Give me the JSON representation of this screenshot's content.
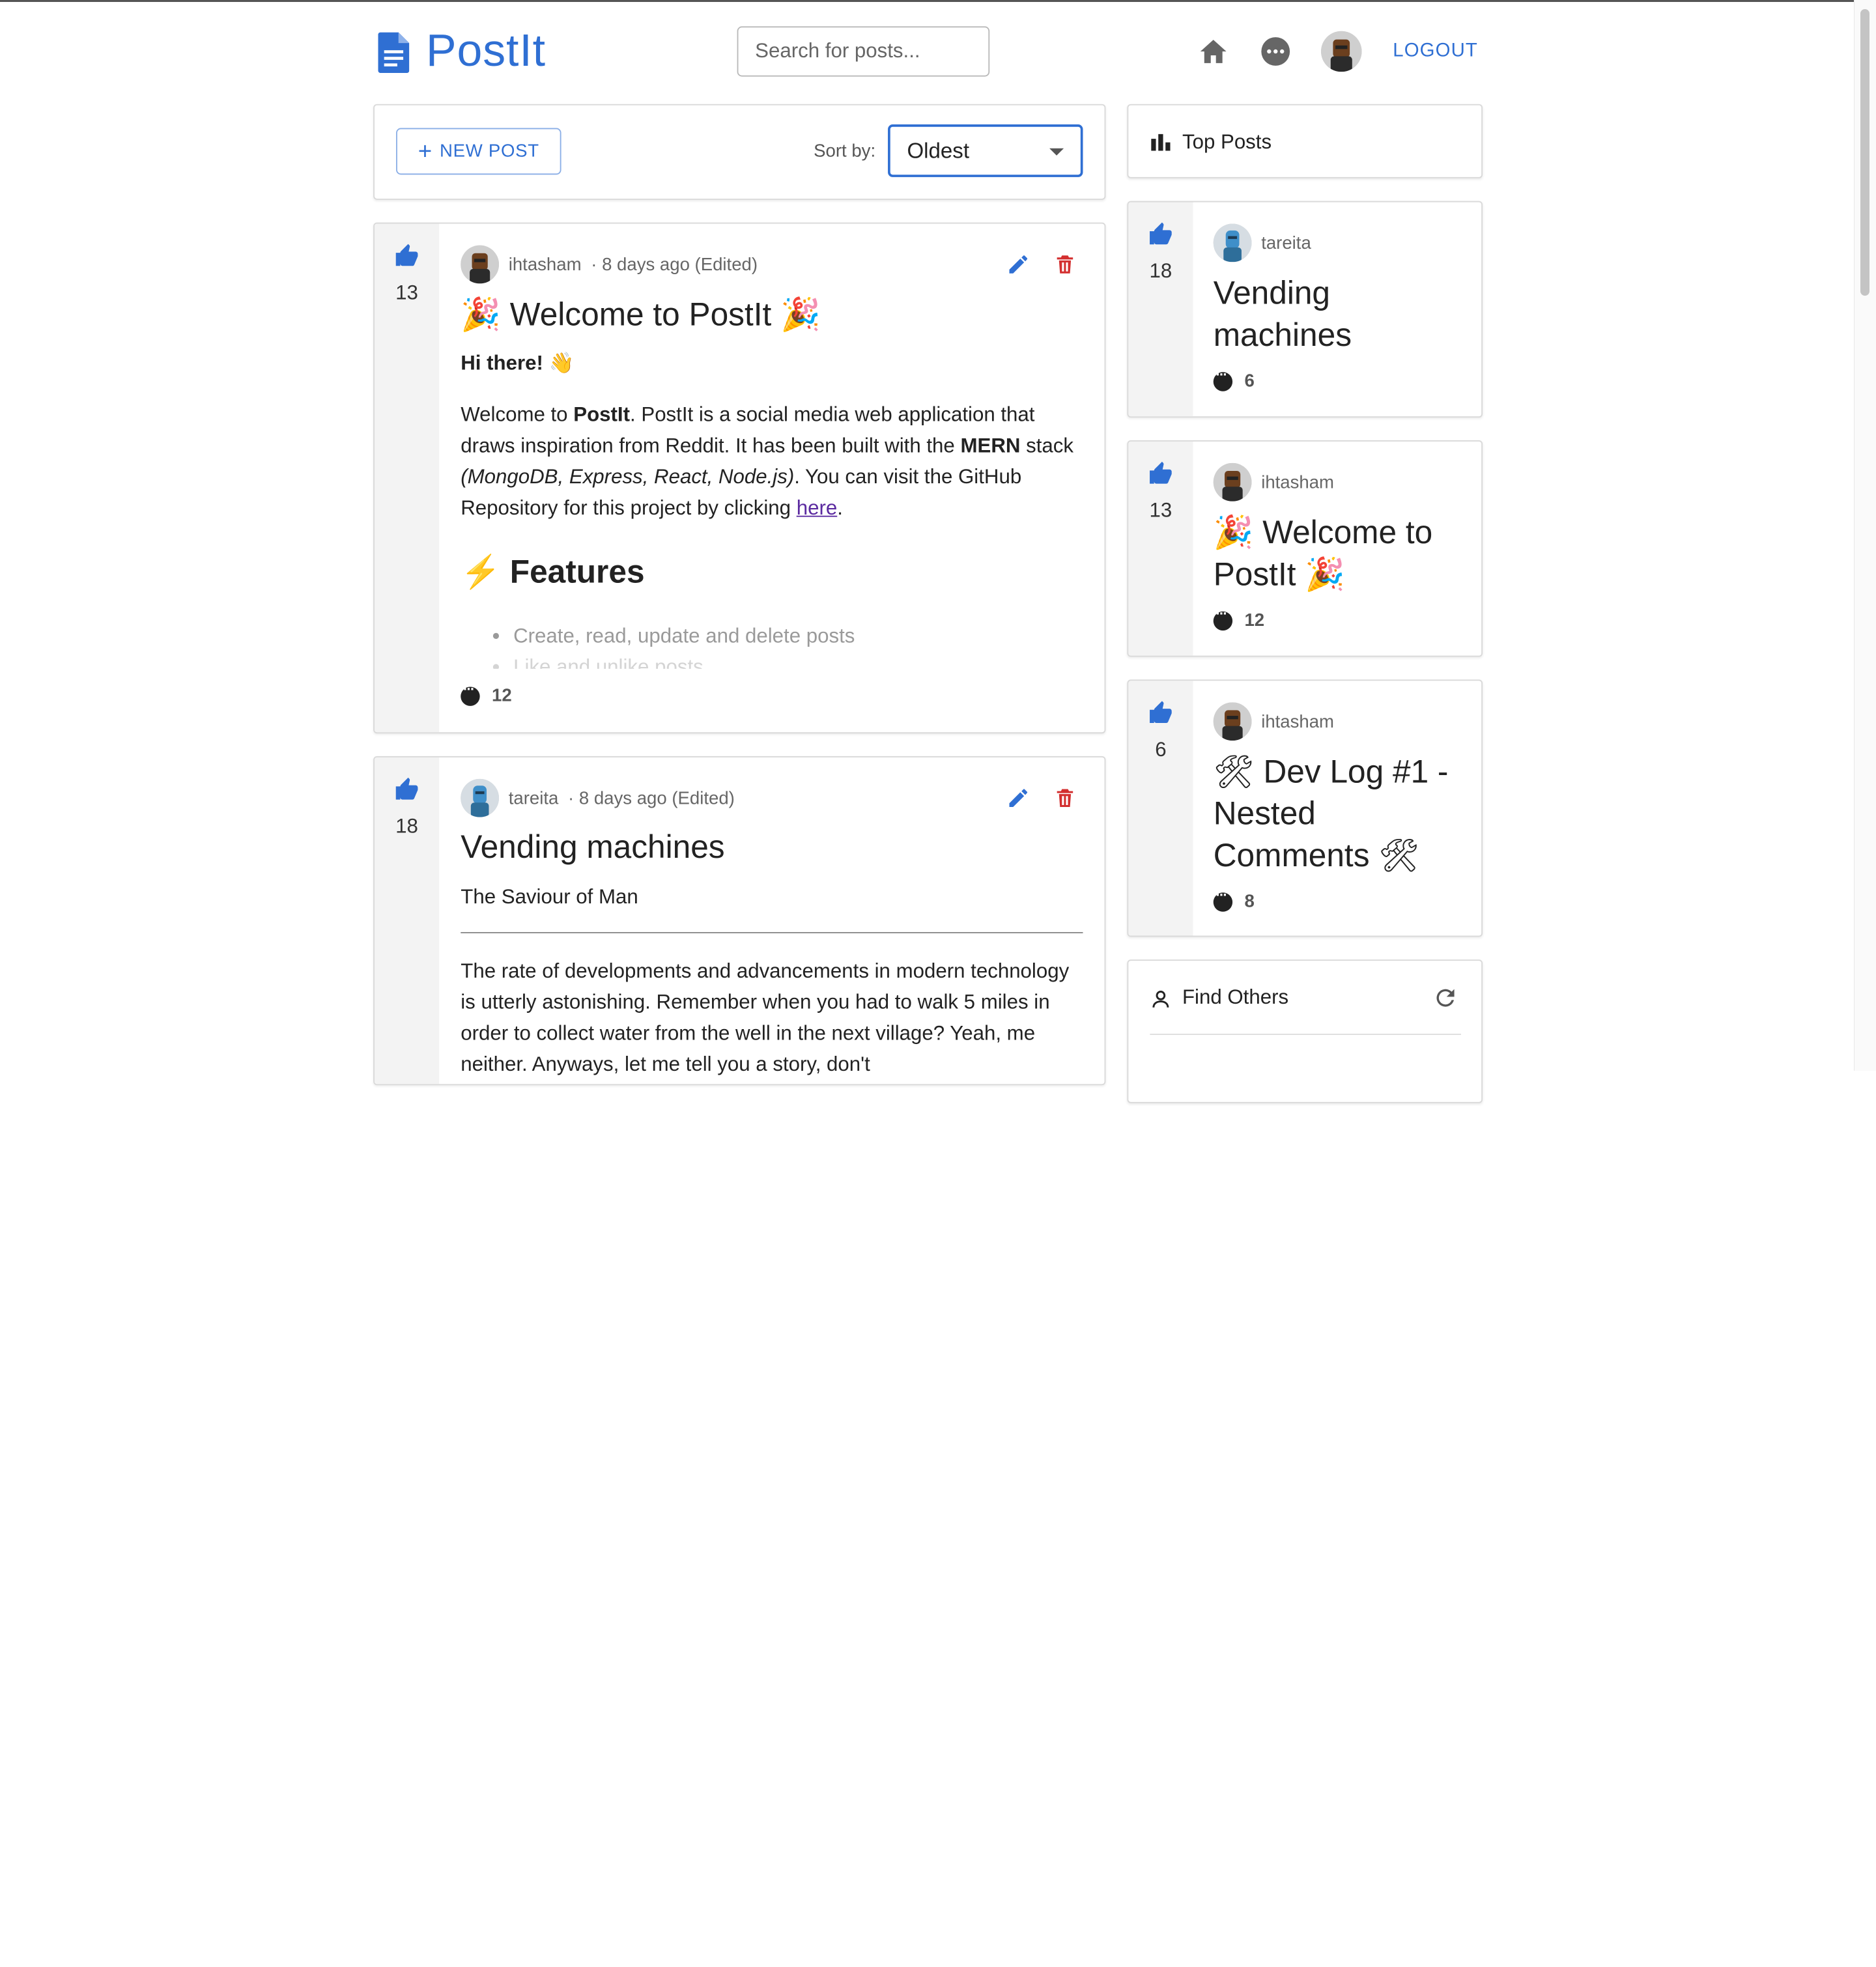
{
  "app": {
    "name": "PostIt"
  },
  "search": {
    "placeholder": "Search for posts..."
  },
  "nav": {
    "logout_label": "LOGOUT"
  },
  "toolbar": {
    "new_post_label": "NEW POST",
    "sort_label": "Sort by:",
    "sort_value": "Oldest"
  },
  "feed": {
    "posts": [
      {
        "likes": "13",
        "author": "ihtasham",
        "meta_suffix": "· 8 days ago (Edited)",
        "title": "🎉 Welcome to PostIt 🎉",
        "greeting": "Hi there! 👋",
        "body_intro": "Welcome to ",
        "body_brand": "PostIt",
        "body_mid": ". PostIt is a social media web application that draws inspiration from Reddit. It has been built with the ",
        "body_mern": "MERN",
        "body_stack": " stack ",
        "body_stack_list": "(MongoDB, Express, React, Node.js)",
        "body_end": ". You can visit the GitHub Repository for this project by clicking ",
        "body_link": "here",
        "features_heading": "⚡ Features",
        "feature_items": [
          "Create, read, update and delete posts",
          "Like and unlike posts"
        ],
        "comments": "12"
      },
      {
        "likes": "18",
        "author": "tareita",
        "meta_suffix": "· 8 days ago (Edited)",
        "title": "Vending machines",
        "subtitle": "The Saviour of Man",
        "body": "The rate of developments and advancements in modern technology is utterly astonishing. Remember when you had to walk 5 miles in order to collect water from the well in the next village? Yeah, me neither. Anyways, let me tell you a story, don't"
      }
    ]
  },
  "sidebar": {
    "top_posts_label": "Top Posts",
    "top_posts": [
      {
        "likes": "18",
        "author": "tareita",
        "title": "Vending machines",
        "comments": "6"
      },
      {
        "likes": "13",
        "author": "ihtasham",
        "title": "🎉 Welcome to PostIt 🎉",
        "comments": "12"
      },
      {
        "likes": "6",
        "author": "ihtasham",
        "title": "🛠 Dev Log #1 - Nested Comments 🛠",
        "comments": "8"
      }
    ],
    "find_others_label": "Find Others"
  },
  "colors": {
    "accent": "#2f6fd3",
    "danger": "#d32f2f",
    "vote_bg": "#f3f3f3"
  }
}
